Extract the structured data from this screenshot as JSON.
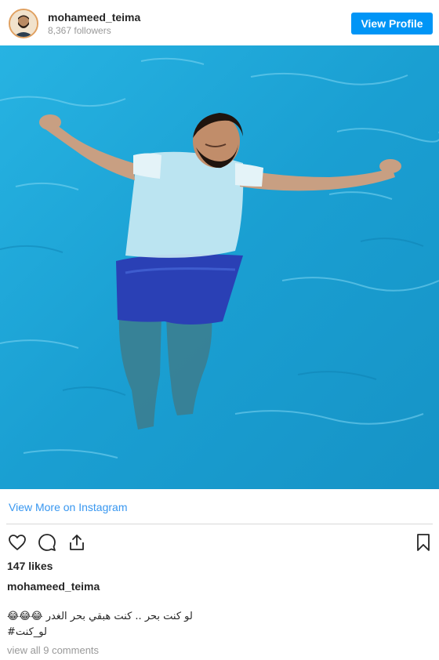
{
  "header": {
    "username": "mohameed_teima",
    "followers": "8,367 followers",
    "view_profile_label": "View Profile"
  },
  "photo": {
    "icon": "photo-man-floating-in-pool",
    "water_color": "#1ea6d6"
  },
  "links": {
    "view_more": "View More on Instagram"
  },
  "actions": {
    "like_icon": "heart-icon",
    "comment_icon": "comment-icon",
    "share_icon": "share-icon",
    "save_icon": "bookmark-icon"
  },
  "post": {
    "likes": "147 likes",
    "author": "mohameed_teima",
    "caption_line1": "😂😂😂 لو كنت بحر .. كنت هبقي بحر الغدر",
    "caption_line2": "#لو_كنت",
    "view_comments": "view all 9 comments"
  },
  "colors": {
    "accent": "#0095f6",
    "link": "#3897f0",
    "muted": "#999999"
  }
}
